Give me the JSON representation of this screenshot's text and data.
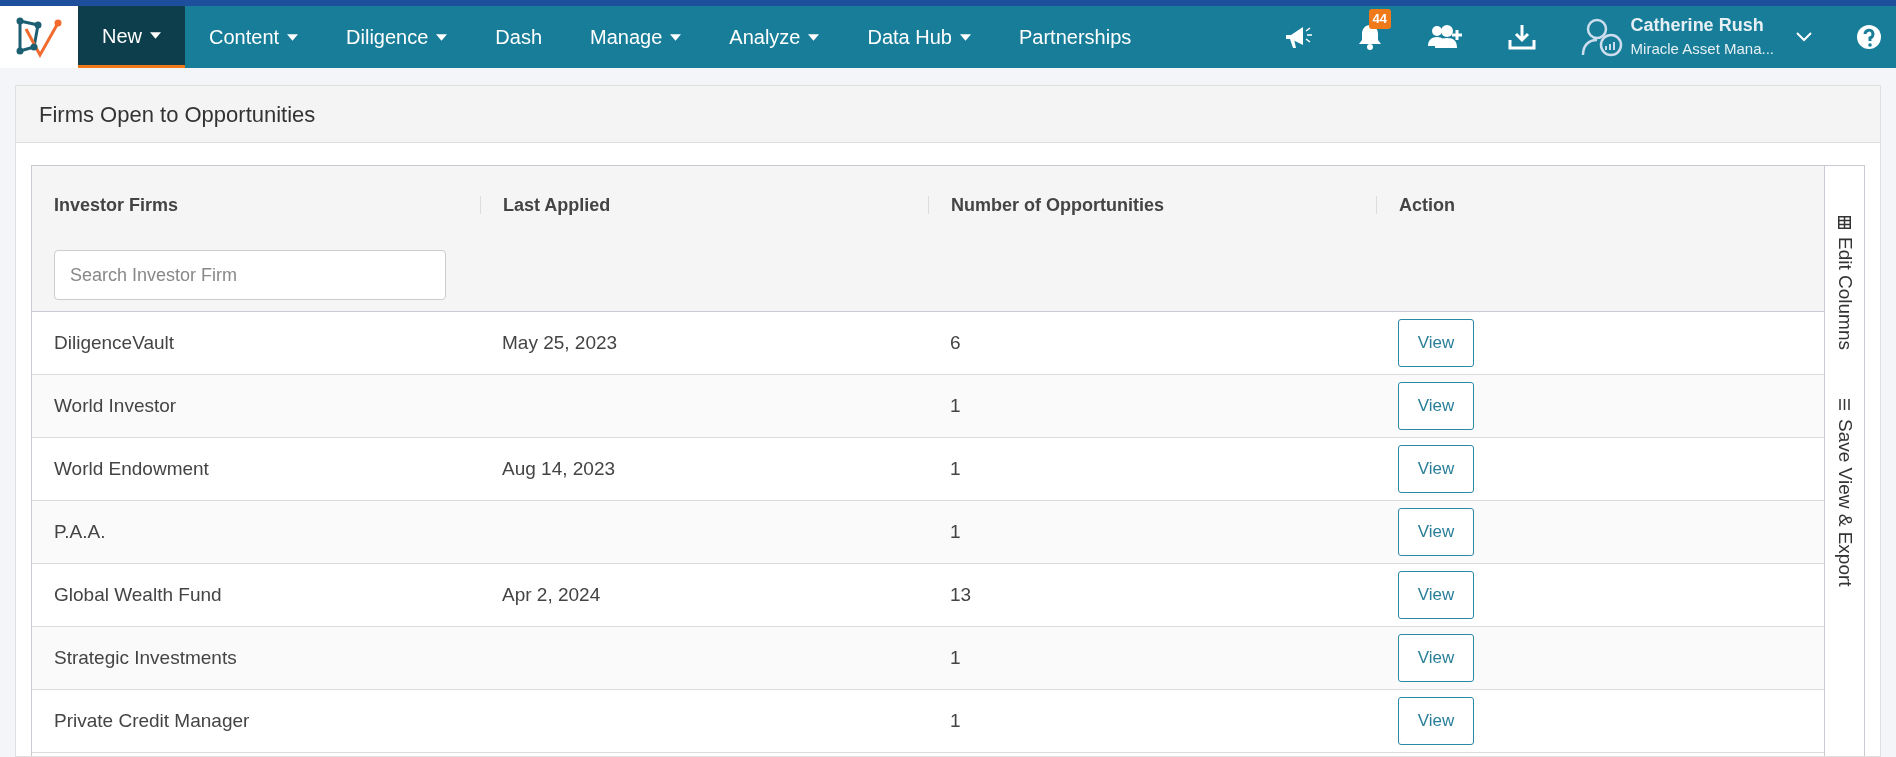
{
  "nav": {
    "items": [
      {
        "label": "New",
        "dropdown": true,
        "selected": true
      },
      {
        "label": "Content",
        "dropdown": true,
        "selected": false
      },
      {
        "label": "Diligence",
        "dropdown": true,
        "selected": false
      },
      {
        "label": "Dash",
        "dropdown": false,
        "selected": false
      },
      {
        "label": "Manage",
        "dropdown": true,
        "selected": false
      },
      {
        "label": "Analyze",
        "dropdown": true,
        "selected": false
      },
      {
        "label": "Data Hub",
        "dropdown": true,
        "selected": false
      },
      {
        "label": "Partnerships",
        "dropdown": false,
        "selected": false
      }
    ],
    "notification_count": "44",
    "user": {
      "name": "Catherine Rush",
      "org": "Miracle Asset Mana..."
    }
  },
  "panel": {
    "title": "Firms Open to Opportunities"
  },
  "table": {
    "columns": [
      "Investor Firms",
      "Last Applied",
      "Number of Opportunities",
      "Action"
    ],
    "search": {
      "placeholder": "Search Investor Firm"
    },
    "rows": [
      {
        "firm": "DiligenceVault",
        "last_applied": "May 25, 2023",
        "opportunities": "6",
        "action": "View"
      },
      {
        "firm": "World Investor",
        "last_applied": "",
        "opportunities": "1",
        "action": "View"
      },
      {
        "firm": "World Endowment",
        "last_applied": "Aug 14, 2023",
        "opportunities": "1",
        "action": "View"
      },
      {
        "firm": "P.A.A.",
        "last_applied": "",
        "opportunities": "1",
        "action": "View"
      },
      {
        "firm": "Global Wealth Fund",
        "last_applied": "Apr 2, 2024",
        "opportunities": "13",
        "action": "View"
      },
      {
        "firm": "Strategic Investments",
        "last_applied": "",
        "opportunities": "1",
        "action": "View"
      },
      {
        "firm": "Private Credit Manager",
        "last_applied": "",
        "opportunities": "1",
        "action": "View"
      }
    ]
  },
  "side_tools": [
    "Edit Columns",
    "Save View & Export"
  ]
}
